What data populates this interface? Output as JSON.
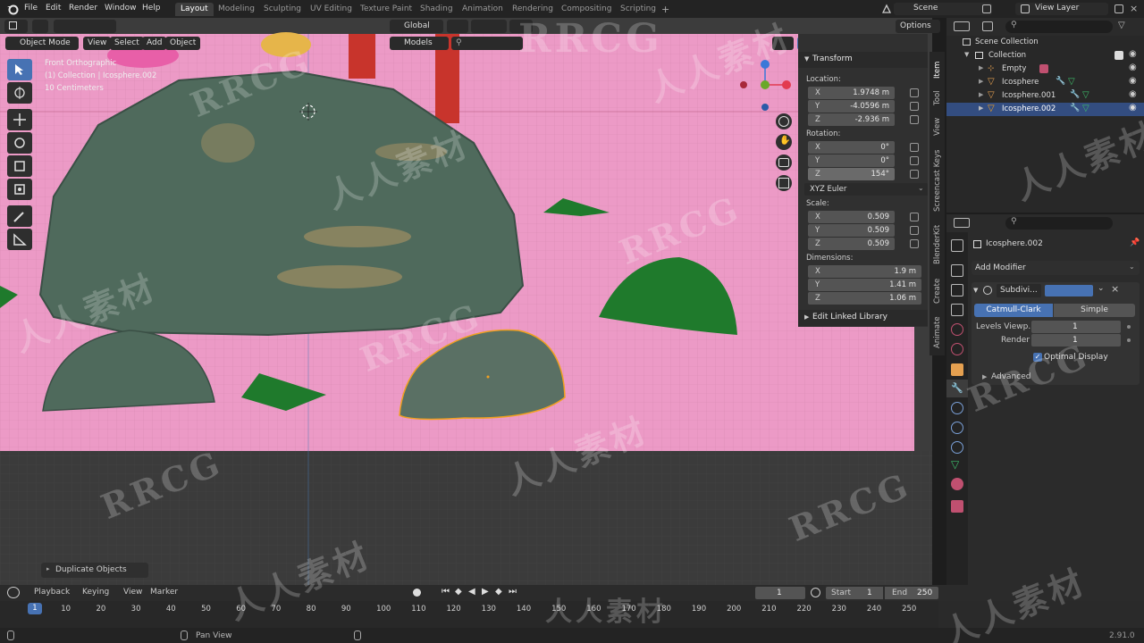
{
  "topbar": {
    "menus": [
      "File",
      "Edit",
      "Render",
      "Window",
      "Help"
    ],
    "workspaces": [
      "Layout",
      "Modeling",
      "Sculpting",
      "UV Editing",
      "Texture Paint",
      "Shading",
      "Animation",
      "Rendering",
      "Compositing",
      "Scripting"
    ],
    "active_workspace": "Layout",
    "scene": "Scene",
    "view_layer": "View Layer"
  },
  "viewport_header": {
    "mode": "Object Mode",
    "menus": [
      "View",
      "Select",
      "Add",
      "Object"
    ],
    "orientation": "Global",
    "collection_filter": "Models",
    "options": "Options"
  },
  "viewport_info": {
    "view": "Front Orthographic",
    "collection": "(1) Collection | Icosphere.002",
    "scale": "10 Centimeters"
  },
  "npanel": {
    "transform_title": "Transform",
    "location_label": "Location:",
    "location": {
      "x": "1.9748 m",
      "y": "-4.0596 m",
      "z": "-2.936 m"
    },
    "rotation_label": "Rotation:",
    "rotation": {
      "x": "0°",
      "y": "0°",
      "z": "154°"
    },
    "rotation_mode": "XYZ Euler",
    "scale_label": "Scale:",
    "scale": {
      "x": "0.509",
      "y": "0.509",
      "z": "0.509"
    },
    "dimensions_label": "Dimensions:",
    "dimensions": {
      "x": "1.9 m",
      "y": "1.41 m",
      "z": "1.06 m"
    },
    "edit_linked_library": "Edit Linked Library",
    "axis_labels": {
      "x": "X",
      "y": "Y",
      "z": "Z"
    },
    "tabs": [
      "Item",
      "Tool",
      "View",
      "Screencast Keys",
      "BlenderKit",
      "Create",
      "Animate"
    ]
  },
  "outliner": {
    "root": "Scene Collection",
    "items": [
      {
        "name": "Collection",
        "selected": false
      },
      {
        "name": "Empty",
        "selected": false
      },
      {
        "name": "Icosphere",
        "selected": false
      },
      {
        "name": "Icosphere.001",
        "selected": false
      },
      {
        "name": "Icosphere.002",
        "selected": true
      }
    ]
  },
  "properties": {
    "object_name": "Icosphere.002",
    "add_modifier": "Add Modifier",
    "modifier_name": "Subdivi...",
    "method_catmull": "Catmull-Clark",
    "method_simple": "Simple",
    "levels_viewport_label": "Levels Viewp...",
    "levels_viewport": "1",
    "render_label": "Render",
    "render_levels": "1",
    "optimal_display": "Optimal Display",
    "optimal_display_checked": true,
    "advanced": "Advanced"
  },
  "operator_panel": "Duplicate Objects",
  "timeline": {
    "menus": [
      "Playback",
      "Keying",
      "View",
      "Marker"
    ],
    "current_frame": "1",
    "start_label": "Start",
    "start": "1",
    "end_label": "End",
    "end": "250",
    "ticks": [
      "10",
      "20",
      "30",
      "40",
      "50",
      "60",
      "70",
      "80",
      "90",
      "100",
      "110",
      "120",
      "130",
      "140",
      "150",
      "160",
      "170",
      "180",
      "190",
      "200",
      "210",
      "220",
      "230",
      "240",
      "250"
    ],
    "playhead": "1"
  },
  "statusbar": {
    "hint": "Pan View",
    "version": "2.91.0"
  },
  "watermark": [
    "RRCG",
    "人人素材"
  ],
  "colors": {
    "accent": "#4772b3",
    "viewport_bg": "#ec9ac6",
    "selection_outline": "#f0a020"
  }
}
